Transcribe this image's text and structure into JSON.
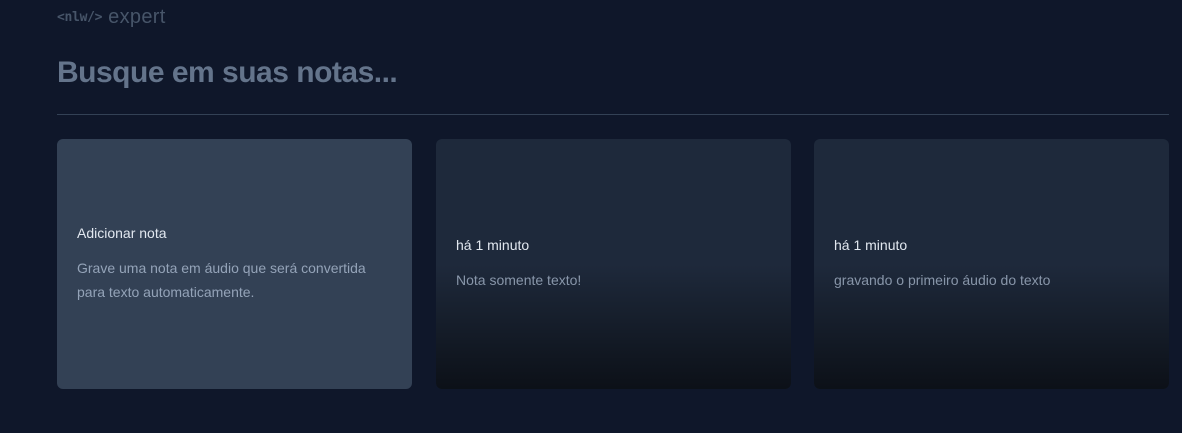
{
  "logo": {
    "prefix": "<nlw/>",
    "name": "expert"
  },
  "search": {
    "placeholder": "Busque em suas notas..."
  },
  "add_note_card": {
    "title": "Adicionar nota",
    "description": "Grave uma nota em áudio que será convertida para texto automaticamente."
  },
  "notes": [
    {
      "date": "há 1 minuto",
      "content": "Nota somente texto!"
    },
    {
      "date": "há 1 minuto",
      "content": "gravando o primeiro áudio do texto"
    }
  ],
  "colors": {
    "background": "#0f172a",
    "add_card": "#334155",
    "note_card": "#1e293b",
    "divider": "#334155",
    "placeholder": "#64748b",
    "logo": "#475569"
  }
}
